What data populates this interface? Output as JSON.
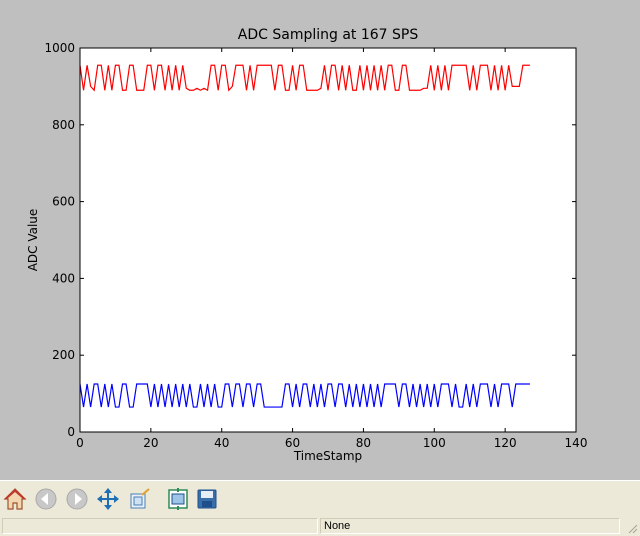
{
  "chart_data": {
    "type": "line",
    "title": "ADC Sampling at 167 SPS",
    "xlabel": "TimeStamp",
    "ylabel": "ADC Value",
    "xlim": [
      0,
      140
    ],
    "ylim": [
      0,
      1000
    ],
    "xticks": [
      "0",
      "20",
      "40",
      "60",
      "80",
      "100",
      "120",
      "140"
    ],
    "yticks": [
      "0",
      "200",
      "400",
      "600",
      "800",
      "1000"
    ],
    "grid": false,
    "series": [
      {
        "color": "#ff0000",
        "x": [
          0,
          1,
          2,
          3,
          4,
          5,
          6,
          7,
          8,
          9,
          10,
          11,
          12,
          13,
          14,
          15,
          16,
          17,
          18,
          19,
          20,
          21,
          22,
          23,
          24,
          25,
          26,
          27,
          28,
          29,
          30,
          31,
          32,
          33,
          34,
          35,
          36,
          37,
          38,
          39,
          40,
          41,
          42,
          43,
          44,
          45,
          46,
          47,
          48,
          49,
          50,
          51,
          52,
          53,
          54,
          55,
          56,
          57,
          58,
          59,
          60,
          61,
          62,
          63,
          64,
          65,
          66,
          67,
          68,
          69,
          70,
          71,
          72,
          73,
          74,
          75,
          76,
          77,
          78,
          79,
          80,
          81,
          82,
          83,
          84,
          85,
          86,
          87,
          88,
          89,
          90,
          91,
          92,
          93,
          94,
          95,
          96,
          97,
          98,
          99,
          100,
          101,
          102,
          103,
          104,
          105,
          106,
          107,
          108,
          109,
          110,
          111,
          112,
          113,
          114,
          115,
          116,
          117,
          118,
          119,
          120,
          121,
          122,
          123,
          124,
          125,
          126,
          127
        ],
        "values": [
          955,
          890,
          955,
          900,
          890,
          955,
          955,
          890,
          955,
          890,
          955,
          955,
          890,
          890,
          955,
          955,
          890,
          890,
          890,
          955,
          955,
          890,
          955,
          955,
          890,
          955,
          890,
          955,
          890,
          955,
          895,
          890,
          890,
          895,
          890,
          895,
          890,
          955,
          955,
          890,
          955,
          955,
          890,
          900,
          955,
          955,
          955,
          890,
          955,
          890,
          955,
          955,
          955,
          955,
          955,
          890,
          955,
          955,
          890,
          890,
          955,
          890,
          955,
          955,
          890,
          890,
          890,
          890,
          895,
          955,
          890,
          955,
          955,
          890,
          955,
          890,
          955,
          890,
          890,
          955,
          890,
          955,
          890,
          955,
          890,
          955,
          890,
          955,
          955,
          890,
          890,
          955,
          955,
          890,
          890,
          890,
          890,
          895,
          895,
          955,
          890,
          955,
          890,
          955,
          890,
          955,
          955,
          955,
          955,
          955,
          890,
          955,
          890,
          955,
          955,
          955,
          890,
          955,
          890,
          955,
          890,
          955,
          900,
          900,
          900,
          955,
          955,
          955
        ]
      },
      {
        "color": "#0000ff",
        "x": [
          0,
          1,
          2,
          3,
          4,
          5,
          6,
          7,
          8,
          9,
          10,
          11,
          12,
          13,
          14,
          15,
          16,
          17,
          18,
          19,
          20,
          21,
          22,
          23,
          24,
          25,
          26,
          27,
          28,
          29,
          30,
          31,
          32,
          33,
          34,
          35,
          36,
          37,
          38,
          39,
          40,
          41,
          42,
          43,
          44,
          45,
          46,
          47,
          48,
          49,
          50,
          51,
          52,
          53,
          54,
          55,
          56,
          57,
          58,
          59,
          60,
          61,
          62,
          63,
          64,
          65,
          66,
          67,
          68,
          69,
          70,
          71,
          72,
          73,
          74,
          75,
          76,
          77,
          78,
          79,
          80,
          81,
          82,
          83,
          84,
          85,
          86,
          87,
          88,
          89,
          90,
          91,
          92,
          93,
          94,
          95,
          96,
          97,
          98,
          99,
          100,
          101,
          102,
          103,
          104,
          105,
          106,
          107,
          108,
          109,
          110,
          111,
          112,
          113,
          114,
          115,
          116,
          117,
          118,
          119,
          120,
          121,
          122,
          123,
          124,
          125,
          126,
          127
        ],
        "values": [
          125,
          65,
          125,
          65,
          125,
          125,
          65,
          125,
          65,
          125,
          65,
          65,
          125,
          125,
          65,
          65,
          125,
          125,
          125,
          125,
          65,
          125,
          65,
          125,
          65,
          125,
          65,
          125,
          65,
          125,
          65,
          125,
          65,
          65,
          125,
          65,
          125,
          65,
          125,
          65,
          65,
          125,
          125,
          65,
          125,
          125,
          65,
          125,
          125,
          65,
          125,
          125,
          65,
          65,
          65,
          65,
          65,
          65,
          125,
          125,
          65,
          125,
          65,
          125,
          125,
          65,
          125,
          65,
          125,
          65,
          125,
          125,
          65,
          125,
          125,
          65,
          125,
          65,
          125,
          65,
          125,
          65,
          125,
          65,
          125,
          65,
          125,
          125,
          125,
          125,
          65,
          125,
          125,
          65,
          125,
          65,
          125,
          65,
          125,
          65,
          125,
          65,
          125,
          125,
          125,
          65,
          125,
          65,
          65,
          125,
          65,
          125,
          65,
          125,
          125,
          125,
          65,
          125,
          65,
          125,
          125,
          125,
          65,
          125,
          125,
          125,
          125,
          125
        ]
      }
    ]
  },
  "toolbar": {
    "buttons": [
      {
        "name": "home-icon",
        "color": "#c0392b"
      },
      {
        "name": "back-icon",
        "color": "#b0b0b0"
      },
      {
        "name": "forward-icon",
        "color": "#b0b0b0"
      },
      {
        "name": "pan-icon",
        "color": "#1f6fb5"
      },
      {
        "name": "zoom-icon",
        "color": "#1f6fb5"
      },
      {
        "name": "subplots-icon",
        "color": "#2e8b57"
      },
      {
        "name": "save-icon",
        "color": "#1f4e8c"
      }
    ]
  },
  "status": {
    "coords": "None"
  }
}
